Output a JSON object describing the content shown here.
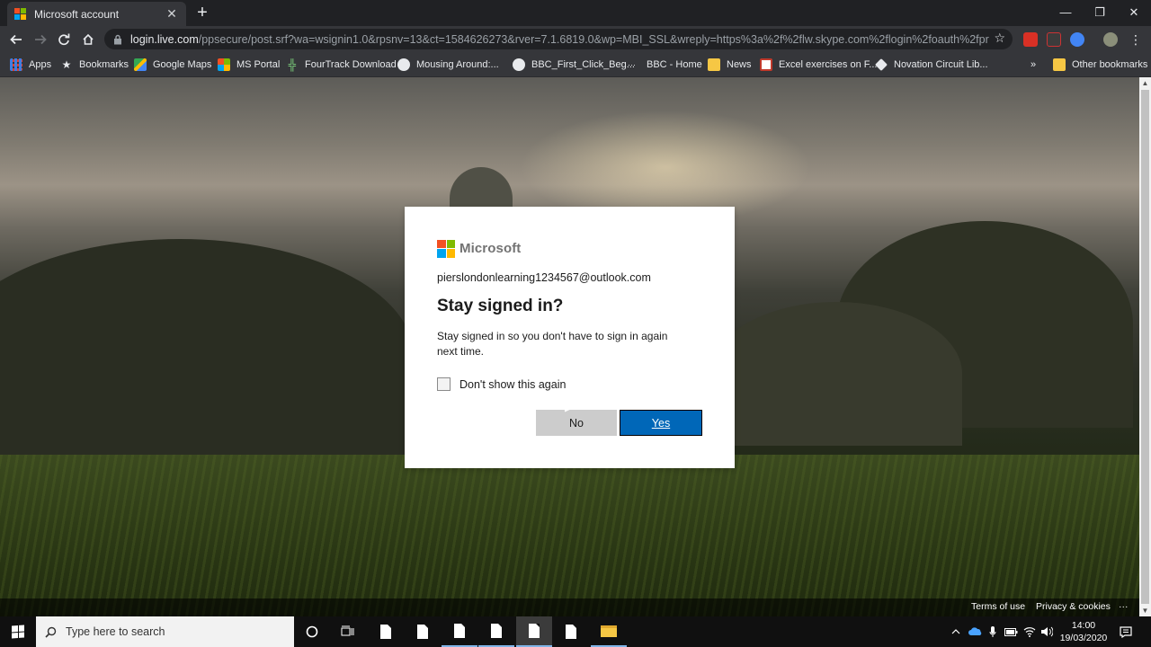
{
  "browser": {
    "tab_title": "Microsoft account",
    "tab_close": "✕",
    "new_tab": "+",
    "window_controls": {
      "minimize": "—",
      "maximize": "❐",
      "close": "✕"
    },
    "url_host": "login.live.com",
    "url_path": "/ppsecure/post.srf?wa=wsignin1.0&rpsnv=13&ct=1584626273&rver=7.1.6819.0&wp=MBI_SSL&wreply=https%3a%2f%2flw.skype.com%2flogin%2foauth%2fproxy%3fcli...",
    "nav_icons": {
      "back": "back-arrow-icon",
      "forward": "forward-arrow-icon",
      "reload": "reload-icon",
      "home": "home-icon"
    }
  },
  "bookmarks": {
    "items": [
      {
        "label": "Apps"
      },
      {
        "label": "Bookmarks"
      },
      {
        "label": "Google Maps"
      },
      {
        "label": "MS Portal"
      },
      {
        "label": "FourTrack Download"
      },
      {
        "label": "Mousing Around:..."
      },
      {
        "label": "BBC_First_Click_Beg..."
      },
      {
        "label": "BBC - Home"
      },
      {
        "label": "News"
      },
      {
        "label": "Excel exercises on F..."
      },
      {
        "label": "Novation Circuit Lib..."
      }
    ],
    "overflow": "»",
    "other": "Other bookmarks"
  },
  "dialog": {
    "brand": "Microsoft",
    "identity": "pierslondonlearning1234567@outlook.com",
    "heading": "Stay signed in?",
    "description": "Stay signed in so you don't have to sign in again next time.",
    "checkbox_label": "Don't show this again",
    "checkbox_checked": false,
    "no_label": "No",
    "yes_label": "Yes"
  },
  "footer": {
    "terms": "Terms of use",
    "privacy": "Privacy & cookies",
    "more": "···"
  },
  "taskbar": {
    "search_placeholder": "Type here to search",
    "time": "14:00",
    "date": "19/03/2020"
  },
  "colors": {
    "ms_red": "#f25022",
    "ms_green": "#7fba00",
    "ms_blue": "#00a4ef",
    "ms_yellow": "#ffb900",
    "yes_button": "#0067b8",
    "no_button": "#cccccc"
  }
}
